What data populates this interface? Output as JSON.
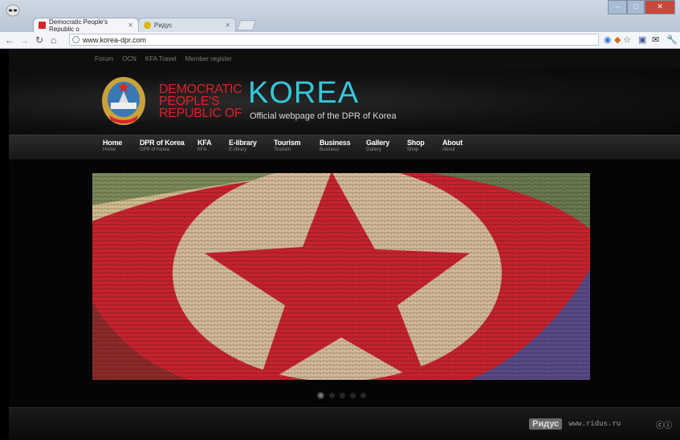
{
  "browser": {
    "tabs": [
      {
        "label": "Democratic People's Republic o",
        "active": true
      },
      {
        "label": "Ридус",
        "active": false
      }
    ],
    "url": "www.korea-dpr.com",
    "colors": {
      "tab_favicon_active": "#d8242a",
      "tab_favicon_inactive": "#e0b400"
    }
  },
  "site": {
    "top_links": [
      "Forum",
      "OCN",
      "KFA Travel",
      "Member register"
    ],
    "brand_lines": [
      "DEMOCRATIC",
      "PEOPLE'S",
      "REPUBLIC OF"
    ],
    "brand_big": "KOREA",
    "tagline": "Official webpage of the DPR of Korea",
    "nav": [
      {
        "main": "Home",
        "sub": "Home"
      },
      {
        "main": "DPR of Korea",
        "sub": "DPR of Korea"
      },
      {
        "main": "KFA",
        "sub": "KFA"
      },
      {
        "main": "E-library",
        "sub": "E-library"
      },
      {
        "main": "Tourism",
        "sub": "Tourism"
      },
      {
        "main": "Business",
        "sub": "Business"
      },
      {
        "main": "Gallery",
        "sub": "Gallery"
      },
      {
        "main": "Shop",
        "sub": "Shop"
      },
      {
        "main": "About",
        "sub": "About"
      }
    ],
    "slider_dot_count": 5,
    "slider_active_dot": 1,
    "colors": {
      "brand_red": "#d8242a",
      "brand_cyan": "#34c7d9"
    }
  },
  "watermark": {
    "logo": "Ридус",
    "url": "www.ridus.ru",
    "license_icons": "cc-by-icons"
  }
}
